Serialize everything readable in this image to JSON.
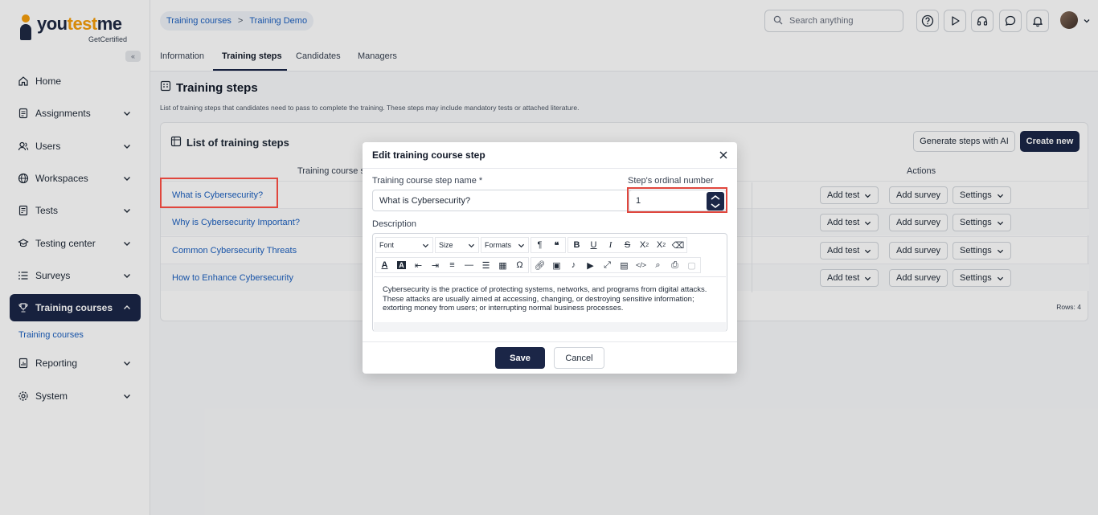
{
  "logo": {
    "text_main": "you",
    "text_accent": "test",
    "text_end": "me",
    "sub": "GetCertified"
  },
  "sidebar": {
    "collapse_glyph": "«",
    "items": [
      {
        "label": "Home",
        "icon": "home-icon"
      },
      {
        "label": "Assignments",
        "icon": "assignments-icon"
      },
      {
        "label": "Users",
        "icon": "users-icon"
      },
      {
        "label": "Workspaces",
        "icon": "globe-icon"
      },
      {
        "label": "Tests",
        "icon": "tests-icon"
      },
      {
        "label": "Testing center",
        "icon": "testing-center-icon"
      },
      {
        "label": "Surveys",
        "icon": "list-icon"
      },
      {
        "label": "Training courses",
        "icon": "trophy-icon"
      },
      {
        "label": "Reporting",
        "icon": "reporting-icon"
      },
      {
        "label": "System",
        "icon": "gear-icon"
      }
    ],
    "sub_item": "Training courses"
  },
  "header": {
    "breadcrumb": [
      "Training courses",
      "Training Demo"
    ],
    "breadcrumb_sep": ">",
    "search_placeholder": "Search anything"
  },
  "tabs": [
    "Information",
    "Training steps",
    "Candidates",
    "Managers"
  ],
  "page": {
    "title": "Training steps",
    "description": "List of training steps that candidates need to pass to complete the training. These steps may include mandatory tests or attached literature."
  },
  "panel": {
    "title": "List of training steps",
    "generate_label": "Generate steps with AI",
    "create_label": "Create new",
    "col_name": "Training course s",
    "col_actions": "Actions",
    "rows": [
      "What is Cybersecurity?",
      "Why is Cybersecurity Important?",
      "Common Cybersecurity Threats",
      "How to Enhance Cybersecurity"
    ],
    "row_actions": {
      "add_test": "Add test",
      "add_survey": "Add survey",
      "settings": "Settings"
    },
    "rows_count": "Rows: 4"
  },
  "modal": {
    "title": "Edit training course step",
    "name_label": "Training course step name",
    "required_mark": "*",
    "name_value": "What is Cybersecurity?",
    "ordinal_label": "Step's ordinal number",
    "ordinal_value": "1",
    "description_label": "Description",
    "toolbar": {
      "font": "Font",
      "size": "Size",
      "formats": "Formats"
    },
    "description_text": "Cybersecurity is the practice of protecting systems, networks, and programs from digital attacks. These attacks are usually aimed at accessing, changing, or destroying sensitive information; extorting money from users; or interrupting normal business processes.",
    "save_label": "Save",
    "cancel_label": "Cancel"
  },
  "colors": {
    "primary": "#1b2647",
    "link": "#1b5fbf",
    "highlight": "#e0463d",
    "accent": "#f59e0b"
  }
}
